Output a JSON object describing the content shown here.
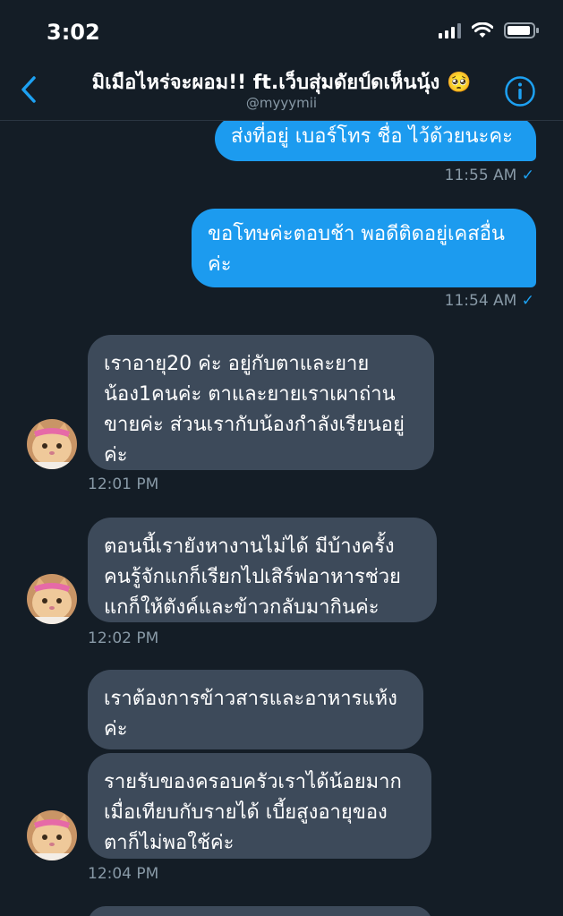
{
  "status": {
    "time": "3:02"
  },
  "header": {
    "title": "มิเมือไหร่จะผอม!! ft.เว็บสุ่มดัยป์ดเห็นนุ้ง 🥺",
    "handle": "@myyymii"
  },
  "messages": [
    {
      "text": "ส่งที่อยู่ เบอร์โทร ชื่อ ไว้ด้วยนะคะ",
      "time": "11:55 AM"
    },
    {
      "text_lines": [
        "ขอโทษค่ะตอบช้า พอดีติดอยู่เคสอื่น",
        "ค่ะ"
      ],
      "time": "11:54 AM"
    },
    {
      "text_lines": [
        "เราอายุ20 ค่ะ อยู่กับตาและยาย",
        "น้อง1คนค่ะ ตาและยายเราเผาถ่าน",
        "ขายค่ะ ส่วนเรากับน้องกำลังเรียนอยู่",
        "ค่ะ"
      ],
      "time": "12:01 PM"
    },
    {
      "text_lines": [
        "ตอนนี้เรายังหางานไม่ได้ มีบ้างครั้ง",
        "คนรู้จักแกก็เรียกไปเสิร์ฟอาหารช่วย",
        "แกก็ให้ตังค์และข้าวกลับมากินค่ะ"
      ],
      "time": "12:02 PM"
    },
    {
      "text_lines": [
        "เราต้องการข้าวสารและอาหารแห้ง",
        "ค่ะ"
      ]
    },
    {
      "text_lines": [
        "รายรับของครอบครัวเราได้น้อยมาก",
        "เมื่อเทียบกับรายได้ เบี้ยสูงอายุของ",
        "ตาก็ไม่พอใช้ค่ะ"
      ],
      "time": "12:04 PM"
    }
  ],
  "colors": {
    "background": "#141d26",
    "outgoing_bubble": "#1c9bef",
    "incoming_bubble": "#3d4a5a",
    "timestamp": "#8899a6",
    "accent": "#1da1f2"
  },
  "icons": [
    "signal-icon",
    "wifi-icon",
    "battery-icon",
    "back-chevron-icon",
    "info-icon",
    "read-check-icon",
    "cat-avatar"
  ]
}
